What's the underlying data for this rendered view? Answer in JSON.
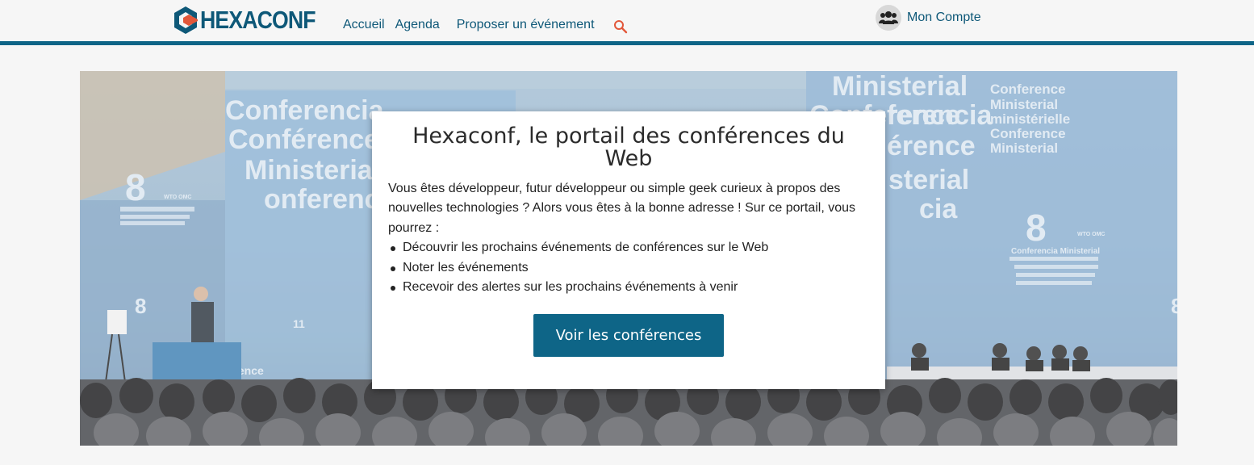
{
  "brand": {
    "name": "HEXACONF",
    "accent": "#0e6587",
    "logo_orange": "#e2573a"
  },
  "nav": {
    "items": [
      "Accueil",
      "Agenda",
      "Proposer un événement"
    ],
    "search_icon": "search-icon"
  },
  "account": {
    "label": "Mon Compte",
    "icon": "users-icon"
  },
  "hero": {
    "backdrop_texts": [
      "Conferencia",
      "Conférence",
      "Ministerial",
      "onferencia",
      "Ministerial",
      "Conference",
      "ferencia",
      "érence",
      "sterial",
      "cia",
      "Conference",
      "Ministerial",
      "ministérielle",
      "Conference",
      "Ministerial",
      "8",
      "8",
      "8",
      "11",
      "11",
      "8",
      "Conferencia Ministerial",
      "WTO OMC",
      "WTO OMC",
      "ference"
    ],
    "title": "Hexaconf, le portail des conférences du Web",
    "intro": "Vous êtes développeur, futur développeur ou simple geek curieux à propos des nouvelles technologies ? Alors vous êtes à la bonne adresse ! Sur ce portail, vous pourrez :",
    "features": [
      "Découvrir les prochains événements de conférences sur le Web",
      "Noter les événements",
      "Recevoir des alertes sur les prochains événements à venir"
    ],
    "cta_label": "Voir les conférences"
  }
}
